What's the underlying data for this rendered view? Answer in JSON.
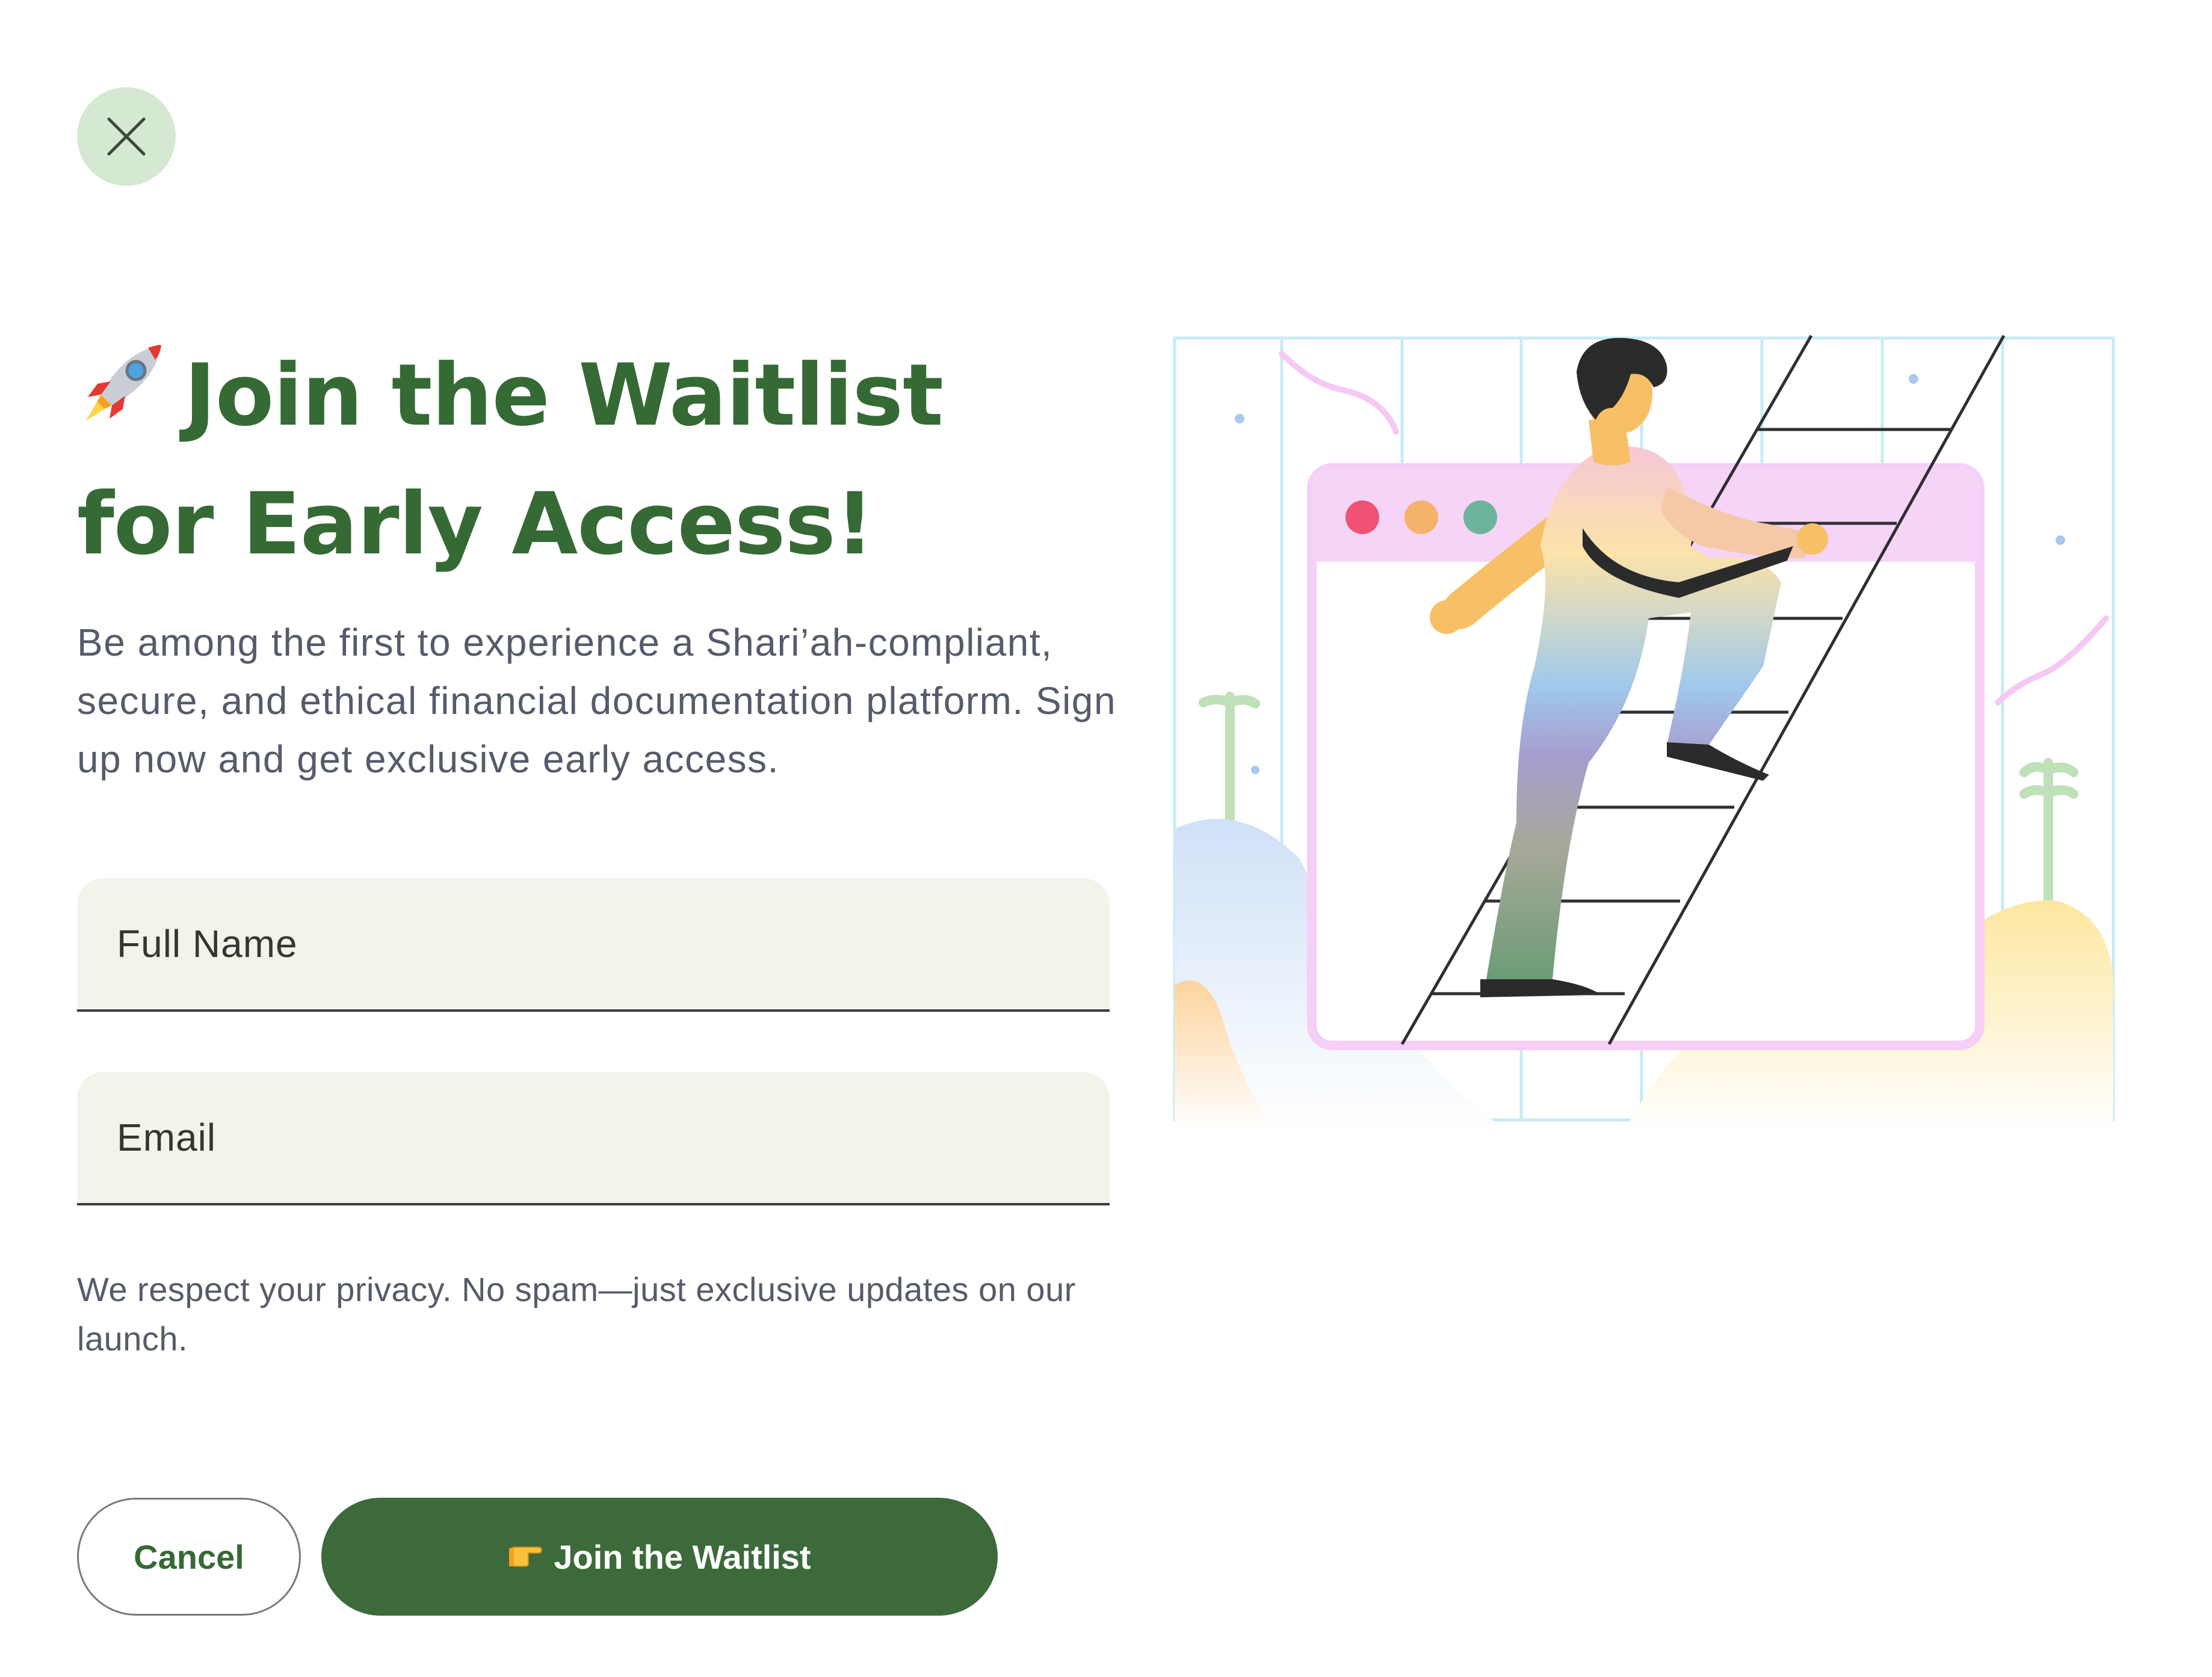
{
  "dialog": {
    "title_line1": "Join the Waitlist",
    "title_line2": "for Early Access!",
    "title_icon": "rocket-icon",
    "intro_text": "Be among the first to experience a Shari’ah-compliant, secure, and ethical financial documentation platform. Sign up now and get exclusive early access.",
    "privacy_note": "We respect your privacy. No spam—just exclusive updates on our launch."
  },
  "form": {
    "name_placeholder": "Full Name",
    "name_value": "",
    "email_placeholder": "Email",
    "email_value": ""
  },
  "actions": {
    "close_icon": "close-icon",
    "cancel_label": "Cancel",
    "join_label": "Join the Waitlist",
    "join_icon": "pointing-hand-icon"
  },
  "colors": {
    "accent": "#3c6a3b",
    "heading": "#356a35",
    "body_text": "#555b6a",
    "close_bg": "#d5e8d1",
    "field_bg": "#f2f4ec"
  }
}
